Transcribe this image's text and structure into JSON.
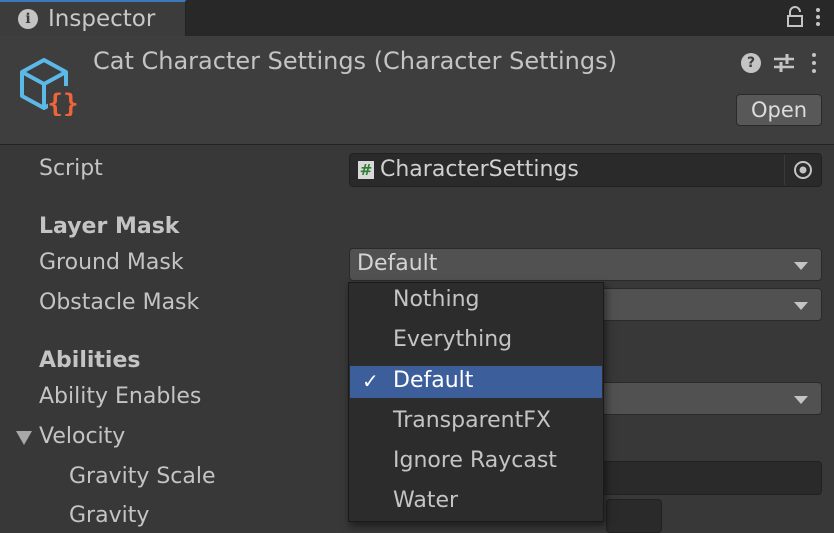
{
  "tab": {
    "icon": "info-icon",
    "label": "Inspector"
  },
  "header": {
    "title": "Cat Character Settings (Character Settings)",
    "open_label": "Open",
    "help_glyph": "?"
  },
  "properties": {
    "script_label": "Script",
    "script_value": "CharacterSettings",
    "script_icon_glyph": "#",
    "layer_mask_header": "Layer Mask",
    "ground_mask_label": "Ground Mask",
    "ground_mask_value": "Default",
    "obstacle_mask_label": "Obstacle Mask",
    "abilities_header": "Abilities",
    "ability_enables_label": "Ability Enables",
    "velocity_label": "Velocity",
    "gravity_scale_label": "Gravity Scale",
    "gravity_label": "Gravity"
  },
  "menu": {
    "check_glyph": "✓",
    "items": [
      {
        "label": "Nothing"
      },
      {
        "label": "Everything"
      },
      {
        "label": "Default",
        "selected": true
      },
      {
        "label": "TransparentFX"
      },
      {
        "label": "Ignore Raycast"
      },
      {
        "label": "Water"
      }
    ]
  },
  "colors": {
    "accent": "#3c5e9a",
    "tab_accent": "#3a79bb",
    "asset_icon_blue": "#5cb8e6",
    "asset_icon_orange": "#f0643c"
  }
}
